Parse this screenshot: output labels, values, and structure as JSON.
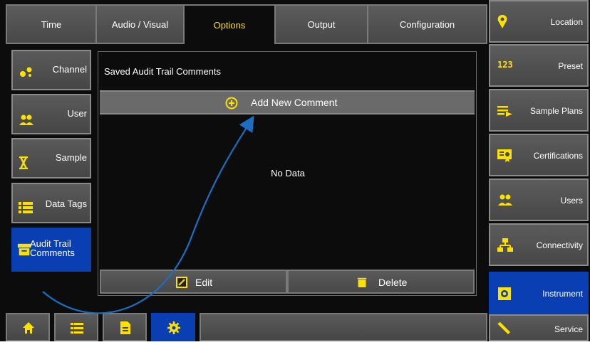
{
  "tabs": [
    {
      "label": "Time",
      "active": false
    },
    {
      "label": "Audio / Visual",
      "active": false
    },
    {
      "label": "Options",
      "active": true
    },
    {
      "label": "Output",
      "active": false
    },
    {
      "label": "Configuration",
      "active": false
    }
  ],
  "left_nav": [
    {
      "label": "Channel",
      "icon": "channel-icon",
      "active": false
    },
    {
      "label": "User",
      "icon": "user-icon",
      "active": false
    },
    {
      "label": "Sample",
      "icon": "hourglass-icon",
      "active": false
    },
    {
      "label": "Data Tags",
      "icon": "list-icon",
      "active": false
    },
    {
      "label": "Audit Trail Comments",
      "line1": "Audit Trail",
      "line2": "Comments",
      "icon": "audit-trail-icon",
      "active": true
    }
  ],
  "panel": {
    "title": "Saved Audit Trail Comments",
    "add_label": "Add New Comment",
    "empty_text": "No Data",
    "edit_label": "Edit",
    "delete_label": "Delete"
  },
  "right_nav": [
    {
      "label": "Location",
      "icon": "location-pin-icon",
      "active": false
    },
    {
      "label": "Preset",
      "icon": "number-123-icon",
      "active": false
    },
    {
      "label": "Sample Plans",
      "icon": "sample-plans-icon",
      "active": false
    },
    {
      "label": "Certifications",
      "icon": "certificate-icon",
      "active": false
    },
    {
      "label": "Users",
      "icon": "users-icon",
      "active": false
    },
    {
      "label": "Connectivity",
      "icon": "network-icon",
      "active": false
    },
    {
      "label": "Instrument",
      "icon": "instrument-icon",
      "active": true
    },
    {
      "label": "Service",
      "icon": "wrench-icon",
      "active": false
    }
  ],
  "bottom_nav": [
    {
      "icon": "home-icon",
      "active": false
    },
    {
      "icon": "list-icon",
      "active": false
    },
    {
      "icon": "document-icon",
      "active": false
    },
    {
      "icon": "gear-icon",
      "active": true
    }
  ],
  "colors": {
    "accent_yellow": "#ffe100",
    "active_blue": "#0a3fb4",
    "annotation_arrow": "#1a6fc2"
  }
}
